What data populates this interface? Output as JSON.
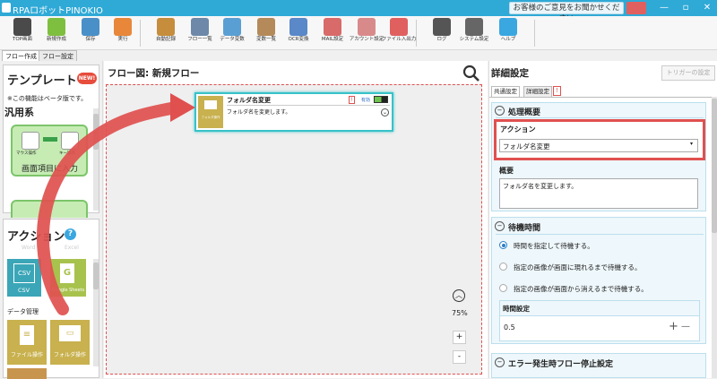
{
  "app": {
    "title": "RPAロボットPINOKIO",
    "feedback": "お客様のご意見をお聞かせください"
  },
  "window": {
    "minimize": "—",
    "restore": "▫",
    "close": "✕"
  },
  "toolbar": [
    {
      "label": "TOP画面",
      "icon": "robot-icon",
      "color": "#4a4a4a"
    },
    {
      "label": "新規作成",
      "icon": "new-file-icon",
      "color": "#7fbf3f"
    },
    {
      "label": "保存",
      "icon": "save-icon",
      "color": "#4a90c8"
    },
    {
      "label": "実行",
      "icon": "run-icon",
      "color": "#e8873a"
    },
    {
      "label": "自動記録",
      "icon": "film-icon",
      "color": "#c58d3c"
    },
    {
      "label": "フロー一覧",
      "icon": "list-icon",
      "color": "#6d88a8"
    },
    {
      "label": "データ変数",
      "icon": "database-icon",
      "color": "#5a9fd4"
    },
    {
      "label": "変数一覧",
      "icon": "box-icon",
      "color": "#b48a5a"
    },
    {
      "label": "OCR変換",
      "icon": "ocr-icon",
      "color": "#5a88c8"
    },
    {
      "label": "MAIL設定",
      "icon": "mail-icon",
      "color": "#d86a6a"
    },
    {
      "label": "アカウント設定",
      "icon": "account-icon",
      "color": "#d88a8a"
    },
    {
      "label": "ファイル入出力",
      "icon": "file-io-icon",
      "color": "#e06060"
    },
    {
      "label": "ログ",
      "icon": "log-icon",
      "color": "#555555"
    },
    {
      "label": "システム設定",
      "icon": "gear-icon",
      "color": "#666666"
    },
    {
      "label": "ヘルプ",
      "icon": "help-icon",
      "color": "#3aa7e0"
    }
  ],
  "tabs": [
    "フロー作成",
    "フロー設定"
  ],
  "left": {
    "template_title": "テンプレート",
    "new_badge": "NEW!",
    "beta_note": "※この機能はベータ版です。",
    "category": "汎用系",
    "template_card_label": "画面項目に入力",
    "mouse_label": "マウス操作",
    "keyboard_label": "キー操作",
    "action_title": "アクション",
    "action_help": "?",
    "cut_labels": [
      "Word",
      "Excel"
    ],
    "actions_row1": [
      {
        "label": "CSV",
        "glyph": "CSV",
        "color": "#3ba6b7"
      },
      {
        "label": "Google Sheets",
        "glyph": "G",
        "color": "#a8c24e"
      }
    ],
    "data_mgmt": "データ管理",
    "actions_row2": [
      {
        "label": "ファイル操作",
        "glyph": "≡",
        "color": "#c8b14e"
      },
      {
        "label": "フォルダ操作",
        "glyph": "▭",
        "color": "#c8b14e"
      }
    ]
  },
  "center": {
    "title": "フロー図: 新規フロー",
    "zoom": "75%",
    "zoom_in": "+",
    "zoom_out": "-",
    "node": {
      "title": "フォルダ名変更",
      "flag": "!",
      "enabled": "有効",
      "description": "フォルダ名を変更します。",
      "thumb_label": "フォルダ操作"
    }
  },
  "right": {
    "title": "詳細設定",
    "trigger_button": "トリガーの設定",
    "tabs": [
      "共通設定",
      "詳細設定"
    ],
    "tab_flag": "!",
    "section1": "処理概要",
    "action_label": "アクション",
    "action_value": "フォルダ名変更",
    "summary_label": "概要",
    "summary_value": "フォルダ名を変更します。",
    "section2": "待機時間",
    "wait_options": [
      "時間を指定して待機する。",
      "指定の画像が画面に現れるまで待機する。",
      "指定の画像が画面から消えるまで待機する。"
    ],
    "wait_selected": 0,
    "time_label": "時間設定",
    "time_value": "0.5",
    "plus": "+",
    "minus": "—",
    "section3": "エラー発生時フロー停止設定",
    "collapse": "−"
  },
  "colors": {
    "accent": "#2fa9d6",
    "highlight": "#e0504f",
    "group_bg": "#eef7fb"
  }
}
